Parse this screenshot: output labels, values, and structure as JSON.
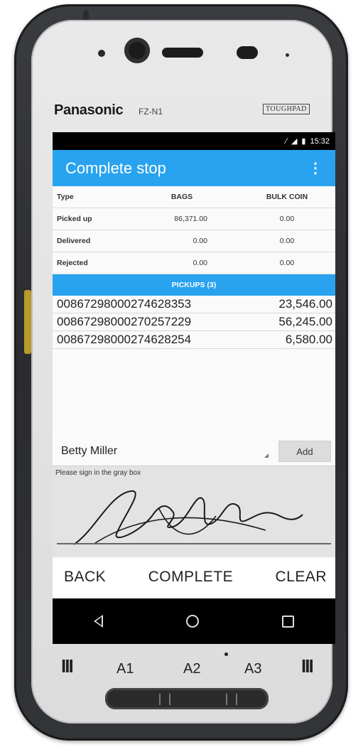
{
  "device": {
    "brand": "Panasonic",
    "model": "FZ-N1",
    "badge": "TOUGHPAD"
  },
  "status_bar": {
    "time": "15:32",
    "icons": [
      "nfc-icon",
      "signal-icon",
      "battery-icon"
    ]
  },
  "app_bar": {
    "title": "Complete stop",
    "menu_icon": "overflow-menu-icon"
  },
  "summary": {
    "headers": [
      "Type",
      "BAGS",
      "BULK COIN"
    ],
    "rows": [
      [
        "Picked up",
        "86,371.00",
        "0.00"
      ],
      [
        "Delivered",
        "0.00",
        "0.00"
      ],
      [
        "Rejected",
        "0.00",
        "0.00"
      ]
    ]
  },
  "pickups": {
    "header": "PICKUPS (3)",
    "items": [
      {
        "id": "00867298000274628353",
        "amount": "23,546.00"
      },
      {
        "id": "00867298000270257229",
        "amount": "56,245.00"
      },
      {
        "id": "00867298000274628254",
        "amount": "6,580.00"
      }
    ]
  },
  "signer": {
    "name": "Betty Miller",
    "add_label": "Add"
  },
  "signature": {
    "hint": "Please sign in the gray box"
  },
  "actions": {
    "back": "BACK",
    "complete": "COMPLETE",
    "clear": "CLEAR"
  },
  "hardware_keys": {
    "left": "III",
    "a1": "A1",
    "a2": "A2",
    "a3": "A3",
    "right": "III"
  },
  "colors": {
    "accent": "#29a3ef",
    "status_bar": "#000000",
    "signature_bg": "#e3e3e3"
  }
}
